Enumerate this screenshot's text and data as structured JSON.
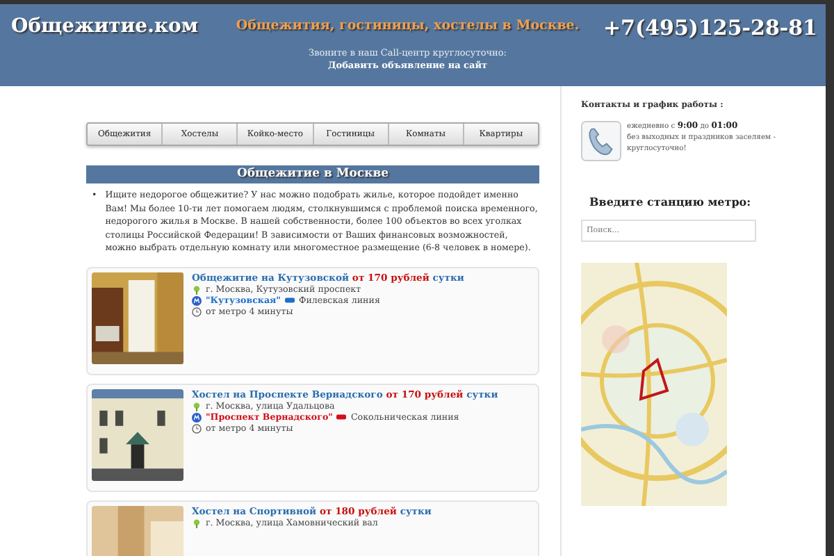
{
  "header": {
    "logo": "Общежитие.ком",
    "tagline": "Общежития, гостиницы, хостелы в Москве.",
    "callcenter": "Звоните в наш Call-центр круглосуточно:",
    "add_link": "Добавить объявление на сайт",
    "phone": "+7(495)125-28-81"
  },
  "nav": [
    {
      "label": "Общежития"
    },
    {
      "label": "Хостелы"
    },
    {
      "label": "Койко-место"
    },
    {
      "label": "Гостиницы"
    },
    {
      "label": "Комнаты"
    },
    {
      "label": "Квартиры"
    }
  ],
  "section_title": "Общежитие в Москве",
  "intro_bullet": "•",
  "intro": "Ищите недорогое общежитие? У нас можно подобрать жилье, которое подойдет именно Вам! Мы более 10-ти лет помогаем людям, столкнувшимся с проблемой поиска временного, недорогого жилья в Москве. В нашей собственности, более 100 объектов во всех уголках столицы Российской Федерации! В зависимости от Ваших финансовых возможностей, можно выбрать отдельную комнату или многоместное размещение (6-8 человек в номере).",
  "listings": [
    {
      "title": "Общежитие на Кутузовской",
      "price": "от 170 рублей",
      "per": "сутки",
      "address": "г. Москва, Кутузовский проспект",
      "station": "\"Кутузовская\"",
      "color": "#1e6fc8",
      "line": "Филевская линия",
      "walk": "от метро 4 минуты",
      "kind": "picture"
    },
    {
      "title": "Хостел на Проспекте Вернадского",
      "price": "от 170 рублей",
      "per": "сутки",
      "address": "г. Москва, улица Удальцова",
      "station": "\"Проспект Вернадского\"",
      "color": "#d0101a",
      "line": "Сокольническая линия",
      "walk": "от метро 4 минуты",
      "kind": "picture"
    },
    {
      "title": "Хостел на Спортивной",
      "price": "от 180 рублей",
      "per": "сутки",
      "address": "г. Москва, улица Хамовнический вал",
      "kind": "picture"
    }
  ],
  "sidebar": {
    "contacts_title": "Контакты и график работы :",
    "hours_prefix": "ежедневно с ",
    "hours_from": "9:00",
    "hours_mid": " до ",
    "hours_to": "01:00",
    "hours_note": "без выходных и праздников заселяем - круглосуточно!",
    "metro_title": "Введите станцию метро:",
    "search": {
      "placeholder": "Поиск..."
    }
  }
}
